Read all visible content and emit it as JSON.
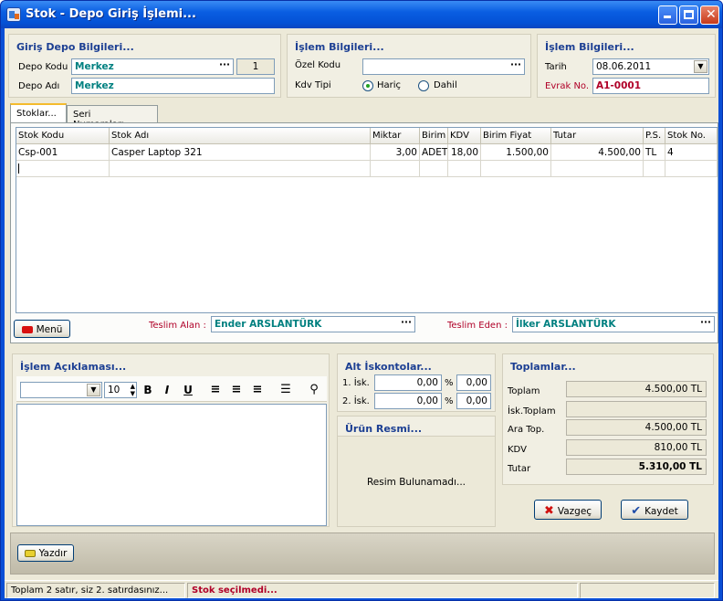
{
  "window": {
    "title": "Stok - Depo Giriş İşlemi..."
  },
  "depo": {
    "title": "Giriş Depo Bilgileri...",
    "kod_label": "Depo Kodu",
    "kod_value": "Merkez",
    "kod_number": "1",
    "ad_label": "Depo Adı",
    "ad_value": "Merkez"
  },
  "islem": {
    "title": "İşlem Bilgileri...",
    "ozel_kod_label": "Özel Kodu",
    "ozel_kod_value": "",
    "kdv_label": "Kdv Tipi",
    "haric_label": "Hariç",
    "dahil_label": "Dahil",
    "kdv_selected": "Hariç"
  },
  "islem2": {
    "title": "İşlem Bilgileri...",
    "tarih_label": "Tarih",
    "tarih_value": "08.06.2011",
    "evrak_label": "Evrak No.",
    "evrak_value": "A1-0001"
  },
  "tabs": [
    {
      "label": "Stoklar..."
    },
    {
      "label": "Seri Numaraları..."
    }
  ],
  "grid": {
    "columns": [
      "Stok Kodu",
      "Stok Adı",
      "Miktar",
      "Birim",
      "KDV",
      "Birim Fiyat",
      "Tutar",
      "P.S.",
      "Stok No."
    ],
    "rows": [
      [
        "Csp-001",
        "Casper Laptop 321",
        "3,00",
        "ADET",
        "18,00",
        "1.500,00",
        "4.500,00",
        "TL",
        "4"
      ]
    ]
  },
  "menu_button": "Menü",
  "teslim": {
    "alan_label": "Teslim Alan :",
    "alan_value": "Ender ARSLANTÜRK",
    "eden_label": "Teslim Eden :",
    "eden_value": "İlker ARSLANTÜRK"
  },
  "aciklama": {
    "title": "İşlem Açıklaması...",
    "font_size": "10"
  },
  "iskonto": {
    "title": "Alt İskontolar...",
    "rows": [
      {
        "label": "1. İsk.",
        "amount": "0,00",
        "pct_sign": "%",
        "pct": "0,00"
      },
      {
        "label": "2. İsk.",
        "amount": "0,00",
        "pct_sign": "%",
        "pct": "0,00"
      }
    ]
  },
  "urun_resmi": {
    "title": "Ürün Resmi...",
    "message": "Resim Bulunamadı..."
  },
  "toplamlar": {
    "title": "Toplamlar...",
    "rows": [
      {
        "label": "Toplam",
        "value": "4.500,00 TL"
      },
      {
        "label": "İsk.Toplam",
        "value": ""
      },
      {
        "label": "Ara Top.",
        "value": "4.500,00 TL"
      },
      {
        "label": "KDV",
        "value": "810,00 TL"
      },
      {
        "label": "Tutar",
        "value": "5.310,00 TL"
      }
    ]
  },
  "buttons": {
    "vazgec": "Vazgeç",
    "kaydet": "Kaydet",
    "yazdir": "Yazdır"
  },
  "status": {
    "left": "Toplam 2 satır, siz 2. satırdasınız...",
    "middle": "Stok seçilmedi...",
    "right": ""
  },
  "colors": {
    "titlebar": "#0a5ee2",
    "group_title": "#1c3f93",
    "teal_value": "#008080",
    "evrak_red": "#b00028"
  }
}
